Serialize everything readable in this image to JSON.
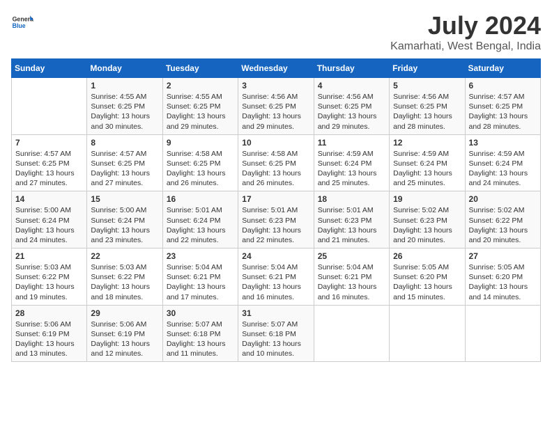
{
  "header": {
    "logo_general": "General",
    "logo_blue": "Blue",
    "month": "July 2024",
    "location": "Kamarhati, West Bengal, India"
  },
  "days_of_week": [
    "Sunday",
    "Monday",
    "Tuesday",
    "Wednesday",
    "Thursday",
    "Friday",
    "Saturday"
  ],
  "weeks": [
    [
      {
        "day": "",
        "data": ""
      },
      {
        "day": "1",
        "data": "Sunrise: 4:55 AM\nSunset: 6:25 PM\nDaylight: 13 hours\nand 30 minutes."
      },
      {
        "day": "2",
        "data": "Sunrise: 4:55 AM\nSunset: 6:25 PM\nDaylight: 13 hours\nand 29 minutes."
      },
      {
        "day": "3",
        "data": "Sunrise: 4:56 AM\nSunset: 6:25 PM\nDaylight: 13 hours\nand 29 minutes."
      },
      {
        "day": "4",
        "data": "Sunrise: 4:56 AM\nSunset: 6:25 PM\nDaylight: 13 hours\nand 29 minutes."
      },
      {
        "day": "5",
        "data": "Sunrise: 4:56 AM\nSunset: 6:25 PM\nDaylight: 13 hours\nand 28 minutes."
      },
      {
        "day": "6",
        "data": "Sunrise: 4:57 AM\nSunset: 6:25 PM\nDaylight: 13 hours\nand 28 minutes."
      }
    ],
    [
      {
        "day": "7",
        "data": "Sunrise: 4:57 AM\nSunset: 6:25 PM\nDaylight: 13 hours\nand 27 minutes."
      },
      {
        "day": "8",
        "data": "Sunrise: 4:57 AM\nSunset: 6:25 PM\nDaylight: 13 hours\nand 27 minutes."
      },
      {
        "day": "9",
        "data": "Sunrise: 4:58 AM\nSunset: 6:25 PM\nDaylight: 13 hours\nand 26 minutes."
      },
      {
        "day": "10",
        "data": "Sunrise: 4:58 AM\nSunset: 6:25 PM\nDaylight: 13 hours\nand 26 minutes."
      },
      {
        "day": "11",
        "data": "Sunrise: 4:59 AM\nSunset: 6:24 PM\nDaylight: 13 hours\nand 25 minutes."
      },
      {
        "day": "12",
        "data": "Sunrise: 4:59 AM\nSunset: 6:24 PM\nDaylight: 13 hours\nand 25 minutes."
      },
      {
        "day": "13",
        "data": "Sunrise: 4:59 AM\nSunset: 6:24 PM\nDaylight: 13 hours\nand 24 minutes."
      }
    ],
    [
      {
        "day": "14",
        "data": "Sunrise: 5:00 AM\nSunset: 6:24 PM\nDaylight: 13 hours\nand 24 minutes."
      },
      {
        "day": "15",
        "data": "Sunrise: 5:00 AM\nSunset: 6:24 PM\nDaylight: 13 hours\nand 23 minutes."
      },
      {
        "day": "16",
        "data": "Sunrise: 5:01 AM\nSunset: 6:24 PM\nDaylight: 13 hours\nand 22 minutes."
      },
      {
        "day": "17",
        "data": "Sunrise: 5:01 AM\nSunset: 6:23 PM\nDaylight: 13 hours\nand 22 minutes."
      },
      {
        "day": "18",
        "data": "Sunrise: 5:01 AM\nSunset: 6:23 PM\nDaylight: 13 hours\nand 21 minutes."
      },
      {
        "day": "19",
        "data": "Sunrise: 5:02 AM\nSunset: 6:23 PM\nDaylight: 13 hours\nand 20 minutes."
      },
      {
        "day": "20",
        "data": "Sunrise: 5:02 AM\nSunset: 6:22 PM\nDaylight: 13 hours\nand 20 minutes."
      }
    ],
    [
      {
        "day": "21",
        "data": "Sunrise: 5:03 AM\nSunset: 6:22 PM\nDaylight: 13 hours\nand 19 minutes."
      },
      {
        "day": "22",
        "data": "Sunrise: 5:03 AM\nSunset: 6:22 PM\nDaylight: 13 hours\nand 18 minutes."
      },
      {
        "day": "23",
        "data": "Sunrise: 5:04 AM\nSunset: 6:21 PM\nDaylight: 13 hours\nand 17 minutes."
      },
      {
        "day": "24",
        "data": "Sunrise: 5:04 AM\nSunset: 6:21 PM\nDaylight: 13 hours\nand 16 minutes."
      },
      {
        "day": "25",
        "data": "Sunrise: 5:04 AM\nSunset: 6:21 PM\nDaylight: 13 hours\nand 16 minutes."
      },
      {
        "day": "26",
        "data": "Sunrise: 5:05 AM\nSunset: 6:20 PM\nDaylight: 13 hours\nand 15 minutes."
      },
      {
        "day": "27",
        "data": "Sunrise: 5:05 AM\nSunset: 6:20 PM\nDaylight: 13 hours\nand 14 minutes."
      }
    ],
    [
      {
        "day": "28",
        "data": "Sunrise: 5:06 AM\nSunset: 6:19 PM\nDaylight: 13 hours\nand 13 minutes."
      },
      {
        "day": "29",
        "data": "Sunrise: 5:06 AM\nSunset: 6:19 PM\nDaylight: 13 hours\nand 12 minutes."
      },
      {
        "day": "30",
        "data": "Sunrise: 5:07 AM\nSunset: 6:18 PM\nDaylight: 13 hours\nand 11 minutes."
      },
      {
        "day": "31",
        "data": "Sunrise: 5:07 AM\nSunset: 6:18 PM\nDaylight: 13 hours\nand 10 minutes."
      },
      {
        "day": "",
        "data": ""
      },
      {
        "day": "",
        "data": ""
      },
      {
        "day": "",
        "data": ""
      }
    ]
  ]
}
